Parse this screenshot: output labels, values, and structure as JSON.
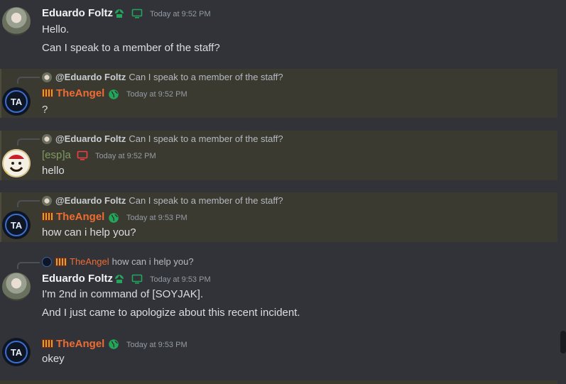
{
  "messages": [
    {
      "author": "Eduardo Foltz",
      "timestamp": "Today at 9:52 PM",
      "lines": [
        "Hello.",
        "Can I speak to a member of the staff?"
      ]
    },
    {
      "reply": {
        "author": "@Eduardo Foltz",
        "text": "Can I speak to a member of the staff?"
      },
      "author": "TheAngel",
      "timestamp": "Today at 9:52 PM",
      "lines": [
        "?"
      ]
    },
    {
      "reply": {
        "author": "@Eduardo Foltz",
        "text": "Can I speak to a member of the staff?"
      },
      "author": "[esp]a",
      "timestamp": "Today at 9:52 PM",
      "lines": [
        "hello"
      ]
    },
    {
      "reply": {
        "author": "@Eduardo Foltz",
        "text": "Can I speak to a member of the staff?"
      },
      "author": "TheAngel",
      "timestamp": "Today at 9:53 PM",
      "lines": [
        "how can i help you?"
      ]
    },
    {
      "reply": {
        "author": "TheAngel",
        "text": "how can i help you?"
      },
      "author": "Eduardo Foltz",
      "timestamp": "Today at 9:53 PM",
      "lines": [
        "I'm 2nd in command of [SOYJAK].",
        "And I just came to apologize about this recent incident."
      ]
    },
    {
      "author": "TheAngel",
      "timestamp": "Today at 9:53 PM",
      "lines": [
        "okey"
      ]
    }
  ],
  "colors": {
    "background": "#313338",
    "mention_highlight": "#3b3a31",
    "name_orange": "#ee6c34",
    "name_green": "#7f9a62",
    "badge_green": "#23a55a",
    "device_red": "#f23f43"
  },
  "icons": [
    "user-avatar",
    "theangel-avatar",
    "esp-avatar",
    "green-leaf-badge-icon",
    "desktop-icon",
    "globe-icon",
    "bars-tag-icon"
  ]
}
